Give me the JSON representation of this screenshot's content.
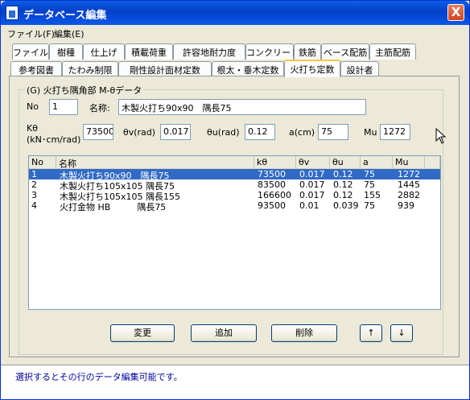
{
  "window": {
    "title": "データベース編集",
    "close_label": "X"
  },
  "menu": [
    {
      "label": "ファイル(F)"
    },
    {
      "label": "編集(E)"
    }
  ],
  "tabs_row1": [
    {
      "label": "ファイル"
    },
    {
      "label": "樹種"
    },
    {
      "label": "仕上げ"
    },
    {
      "label": "積載荷重"
    },
    {
      "label": "許容地耐力度"
    },
    {
      "label": "コンクリート"
    },
    {
      "label": "鉄筋"
    },
    {
      "label": "ベース配筋"
    },
    {
      "label": "主筋配筋"
    }
  ],
  "tabs_row2": [
    {
      "label": "参考図書"
    },
    {
      "label": "たわみ制限"
    },
    {
      "label": "剛性設計面材定数"
    },
    {
      "label": "根太・垂木定数"
    },
    {
      "label": "火打ち定数"
    },
    {
      "label": "設計者"
    }
  ],
  "group": {
    "title": "(G) 火打ち隅角部 M-θデータ"
  },
  "form": {
    "no_label": "No",
    "no_value": "1",
    "name_label": "名称:",
    "name_value": "木製火打ち90x90　隅長75",
    "k_label_1": "Kθ",
    "k_label_2": "(kN･cm/rad)",
    "k_value": "73500",
    "thv_label": "θv(rad)",
    "thv_value": "0.017",
    "thu_label": "θu(rad)",
    "thu_value": "0.12",
    "a_label": "a(cm)",
    "a_value": "75",
    "mu_label": "Mu",
    "mu_value": "1272"
  },
  "list": {
    "headers": [
      "No",
      "名称",
      "kθ",
      "θv",
      "θu",
      "a",
      "Mu"
    ],
    "rows": [
      {
        "no": "1",
        "name": "木製火打ち90x90　隅長75",
        "k": "73500",
        "thv": "0.017",
        "thu": "0.12",
        "a": "75",
        "mu": "1272"
      },
      {
        "no": "2",
        "name": "木製火打ち105x105  隅長75",
        "k": "83500",
        "thv": "0.017",
        "thu": "0.12",
        "a": "75",
        "mu": "1445"
      },
      {
        "no": "3",
        "name": "木製火打ち105x105  隅長155",
        "k": "166600",
        "thv": "0.017",
        "thu": "0.12",
        "a": "155",
        "mu": "2882"
      },
      {
        "no": "4",
        "name": "火打金物 HB　　　隅長75",
        "k": "93500",
        "thv": "0.01",
        "thu": "0.039",
        "a": "75",
        "mu": "939"
      }
    ]
  },
  "buttons": {
    "change": "変更",
    "add": "追加",
    "delete": "削除",
    "up": "↑",
    "down": "↓"
  },
  "status": {
    "text": "選択するとその行のデータ編集可能です。"
  },
  "colors": {
    "selection": "#316ac5",
    "titlebar": "#0541c9",
    "status_text": "#0000a0"
  }
}
